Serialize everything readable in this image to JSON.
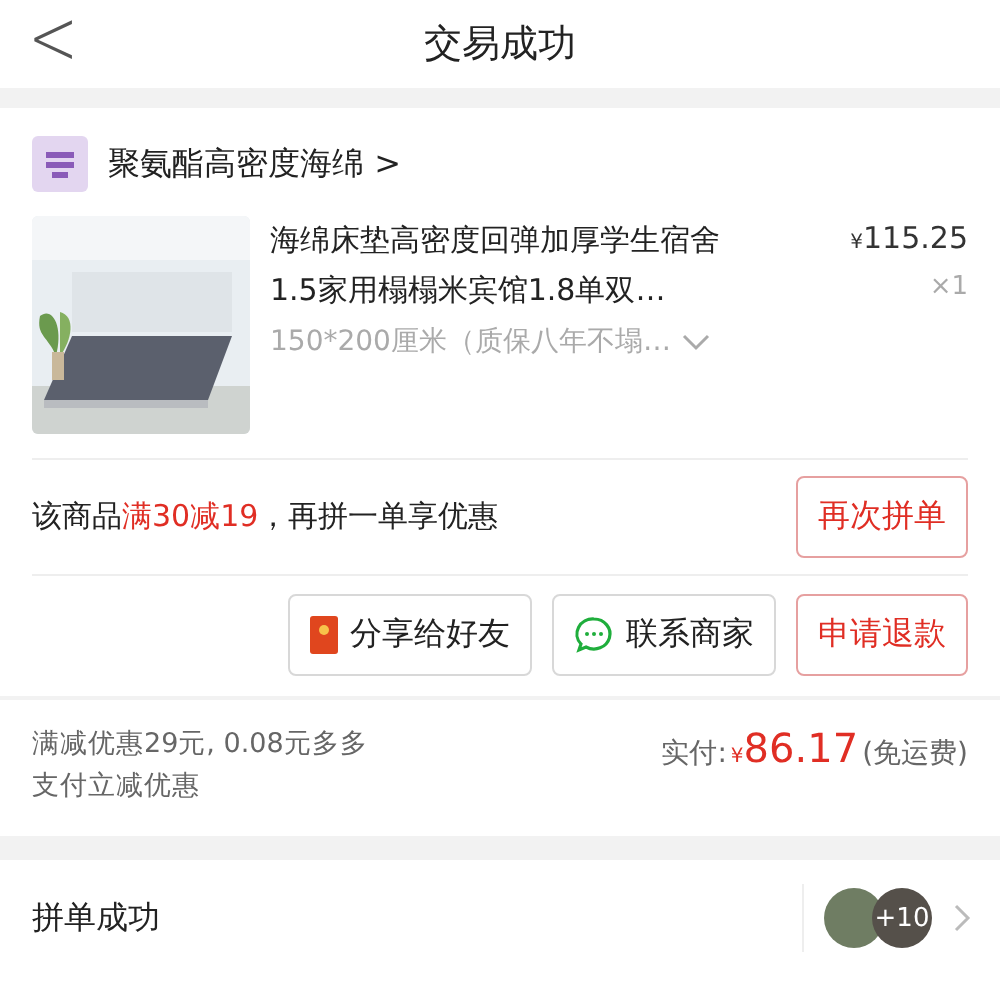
{
  "header": {
    "back": "<",
    "title": "交易成功"
  },
  "shop": {
    "name": "聚氨酯高密度海绵",
    "chevron": ">"
  },
  "product": {
    "title": "海绵床垫高密度回弹加厚学生宿舍1.5家用榻榻米宾馆1.8单双…",
    "currency": "¥",
    "price": "115.25",
    "quantity": "×1",
    "spec": "150*200厘米（质保八年不塌…"
  },
  "promo": {
    "prefix": "该商品",
    "highlight": "满30减19",
    "suffix": "，再拼一单享优惠",
    "button": "再次拼单"
  },
  "actions": [
    {
      "label": "分享给好友",
      "kind": "share"
    },
    {
      "label": "联系商家",
      "kind": "chat"
    },
    {
      "label": "申请退款",
      "kind": "refund"
    }
  ],
  "payment": {
    "discount_note": "满减优惠29元, 0.08元多多支付立减优惠",
    "paid_label": "实付:",
    "currency": "¥",
    "amount": "86.17",
    "shipping": "(免运费)"
  },
  "group": {
    "status": "拼单成功",
    "extra_count": "+10"
  }
}
